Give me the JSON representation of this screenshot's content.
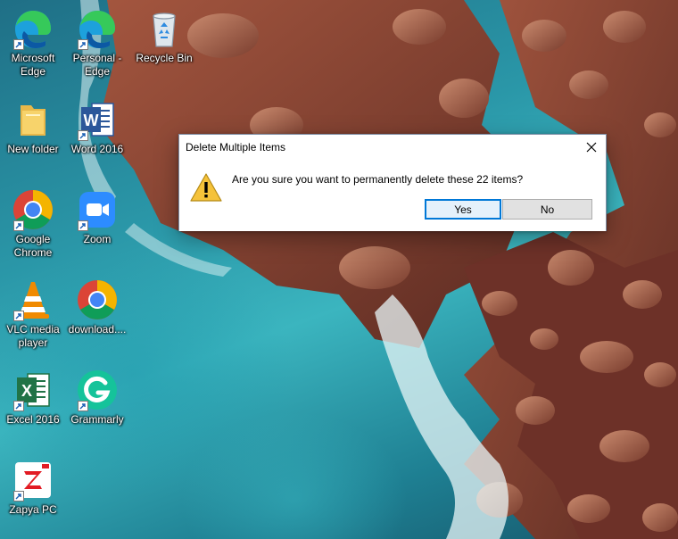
{
  "desktop": {
    "icons": [
      {
        "id": "microsoft-edge",
        "label": "Microsoft Edge",
        "icon": "edge-icon"
      },
      {
        "id": "personal-edge",
        "label": "Personal - Edge",
        "icon": "edge-icon"
      },
      {
        "id": "recycle-bin",
        "label": "Recycle Bin",
        "icon": "recycle-bin-icon"
      },
      {
        "id": "new-folder",
        "label": "New folder",
        "icon": "folder-icon"
      },
      {
        "id": "word-2016",
        "label": "Word 2016",
        "icon": "word-icon"
      },
      {
        "id": "google-chrome",
        "label": "Google Chrome",
        "icon": "chrome-icon"
      },
      {
        "id": "zoom",
        "label": "Zoom",
        "icon": "zoom-icon"
      },
      {
        "id": "vlc",
        "label": "VLC media player",
        "icon": "vlc-icon"
      },
      {
        "id": "download",
        "label": "download....",
        "icon": "chrome-icon"
      },
      {
        "id": "excel-2016",
        "label": "Excel 2016",
        "icon": "excel-icon"
      },
      {
        "id": "grammarly",
        "label": "Grammarly",
        "icon": "grammarly-icon"
      },
      {
        "id": "zapya",
        "label": "Zapya PC",
        "icon": "zapya-icon"
      }
    ]
  },
  "dialog": {
    "title": "Delete Multiple Items",
    "message": "Are you sure you want to permanently delete these 22 items?",
    "icon": "warning-icon",
    "yes_label": "Yes",
    "no_label": "No",
    "close_icon": "close-icon",
    "accent_color": "#0078d7"
  }
}
